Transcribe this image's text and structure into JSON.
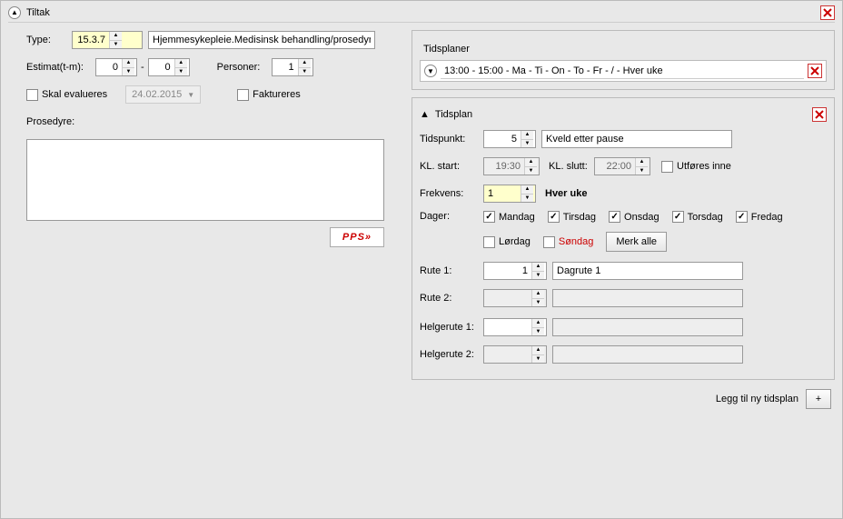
{
  "panel": {
    "title": "Tiltak",
    "type_label": "Type:",
    "type_value": "15.3.7",
    "type_desc": "Hjemmesykepleie.Medisinsk behandling/prosedyr",
    "estimat_label": "Estimat(t-m):",
    "estimat_h": "0",
    "estimat_m": "0",
    "personer_label": "Personer:",
    "personer_value": "1",
    "skal_evalueres": "Skal evalueres",
    "eval_date": "24.02.2015",
    "faktureres": "Faktureres",
    "prosedyre_label": "Prosedyre:",
    "pps": "PPS»"
  },
  "tidsplaner": {
    "group_title": "Tidsplaner",
    "summary": "13:00 - 15:00 - Ma - Ti - On - To - Fr -  /  - Hver uke"
  },
  "tidsplan": {
    "group_title": "Tidsplan",
    "tidspunkt_label": "Tidspunkt:",
    "tidspunkt_value": "5",
    "tidspunkt_desc": "Kveld etter pause",
    "kl_start_label": "KL. start:",
    "kl_start": "19:30",
    "kl_slutt_label": "KL. slutt:",
    "kl_slutt": "22:00",
    "utfores_inne": "Utføres inne",
    "frekvens_label": "Frekvens:",
    "frekvens_value": "1",
    "frekvens_desc": "Hver uke",
    "dager_label": "Dager:",
    "days": {
      "mandag": {
        "label": "Mandag",
        "checked": true
      },
      "tirsdag": {
        "label": "Tirsdag",
        "checked": true
      },
      "onsdag": {
        "label": "Onsdag",
        "checked": true
      },
      "torsdag": {
        "label": "Torsdag",
        "checked": true
      },
      "fredag": {
        "label": "Fredag",
        "checked": true
      },
      "lordag": {
        "label": "Lørdag",
        "checked": false
      },
      "sondag": {
        "label": "Søndag",
        "checked": false
      }
    },
    "merk_alle": "Merk alle",
    "rute1_label": "Rute 1:",
    "rute1_value": "1",
    "rute1_desc": "Dagrute 1",
    "rute2_label": "Rute 2:",
    "helgerute1_label": "Helgerute 1:",
    "helgerute2_label": "Helgerute 2:"
  },
  "footer": {
    "legg_til": "Legg til ny tidsplan",
    "plus": "+"
  }
}
